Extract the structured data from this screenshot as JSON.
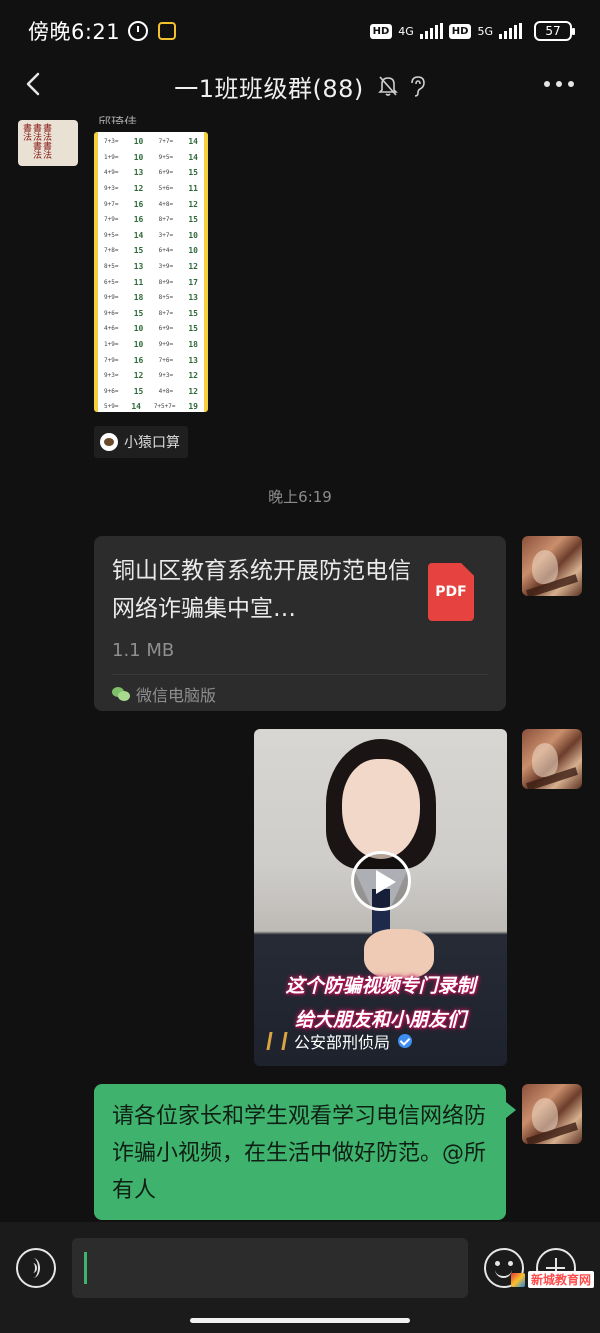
{
  "status_bar": {
    "time": "傍晚6:21",
    "hd1": "HD",
    "net1": "4G",
    "hd2": "HD",
    "net2": "5G",
    "battery": "57"
  },
  "header": {
    "title": "一1班班级群(88)"
  },
  "messages": {
    "partial_sender": "邱琦佳",
    "worksheet_rows": [
      [
        "7+3=",
        "10",
        "7+7=",
        "14"
      ],
      [
        "1+9=",
        "10",
        "9+5=",
        "14"
      ],
      [
        "4+9=",
        "13",
        "6+9=",
        "15"
      ],
      [
        "9+3=",
        "12",
        "5+6=",
        "11"
      ],
      [
        "9+7=",
        "16",
        "4+8=",
        "12"
      ],
      [
        "7+9=",
        "16",
        "8+7=",
        "15"
      ],
      [
        "9+5=",
        "14",
        "3+7=",
        "10"
      ],
      [
        "7+8=",
        "15",
        "6+4=",
        "10"
      ],
      [
        "8+5=",
        "13",
        "3+9=",
        "12"
      ],
      [
        "6+5=",
        "11",
        "8+9=",
        "17"
      ],
      [
        "9+9=",
        "18",
        "8+5=",
        "13"
      ],
      [
        "9+6=",
        "15",
        "8+7=",
        "15"
      ],
      [
        "4+6=",
        "10",
        "6+9=",
        "15"
      ],
      [
        "1+9=",
        "10",
        "9+9=",
        "18"
      ],
      [
        "7+9=",
        "16",
        "7+6=",
        "13"
      ],
      [
        "9+3=",
        "12",
        "9+3=",
        "12"
      ],
      [
        "9+6=",
        "15",
        "4+8=",
        "12"
      ],
      [
        "5+9=",
        "14",
        "7+5+7=",
        "19"
      ],
      [
        "7+8=",
        "15",
        "7+4=",
        "11"
      ]
    ],
    "mini_app_label": "小猿口算",
    "timestamp": "晚上6:19",
    "file": {
      "name": "铜山区教育系统开展防范电信网络诈骗集中宣…",
      "size": "1.1 MB",
      "type_label": "PDF",
      "source": "微信电脑版"
    },
    "video": {
      "caption_line1": "这个防骗视频专门录制",
      "caption_line2": "给大朋友和小朋友们",
      "source": "公安部刑侦局"
    },
    "text": "请各位家长和学生观看学习电信网络防诈骗小视频，在生活中做好防范。@所有人"
  },
  "watermark": {
    "text": "新城教育网"
  },
  "colors": {
    "background": "#111111",
    "bubble_green": "#3fb36e",
    "file_card": "#2c2c2c",
    "pdf_red": "#e64340"
  }
}
